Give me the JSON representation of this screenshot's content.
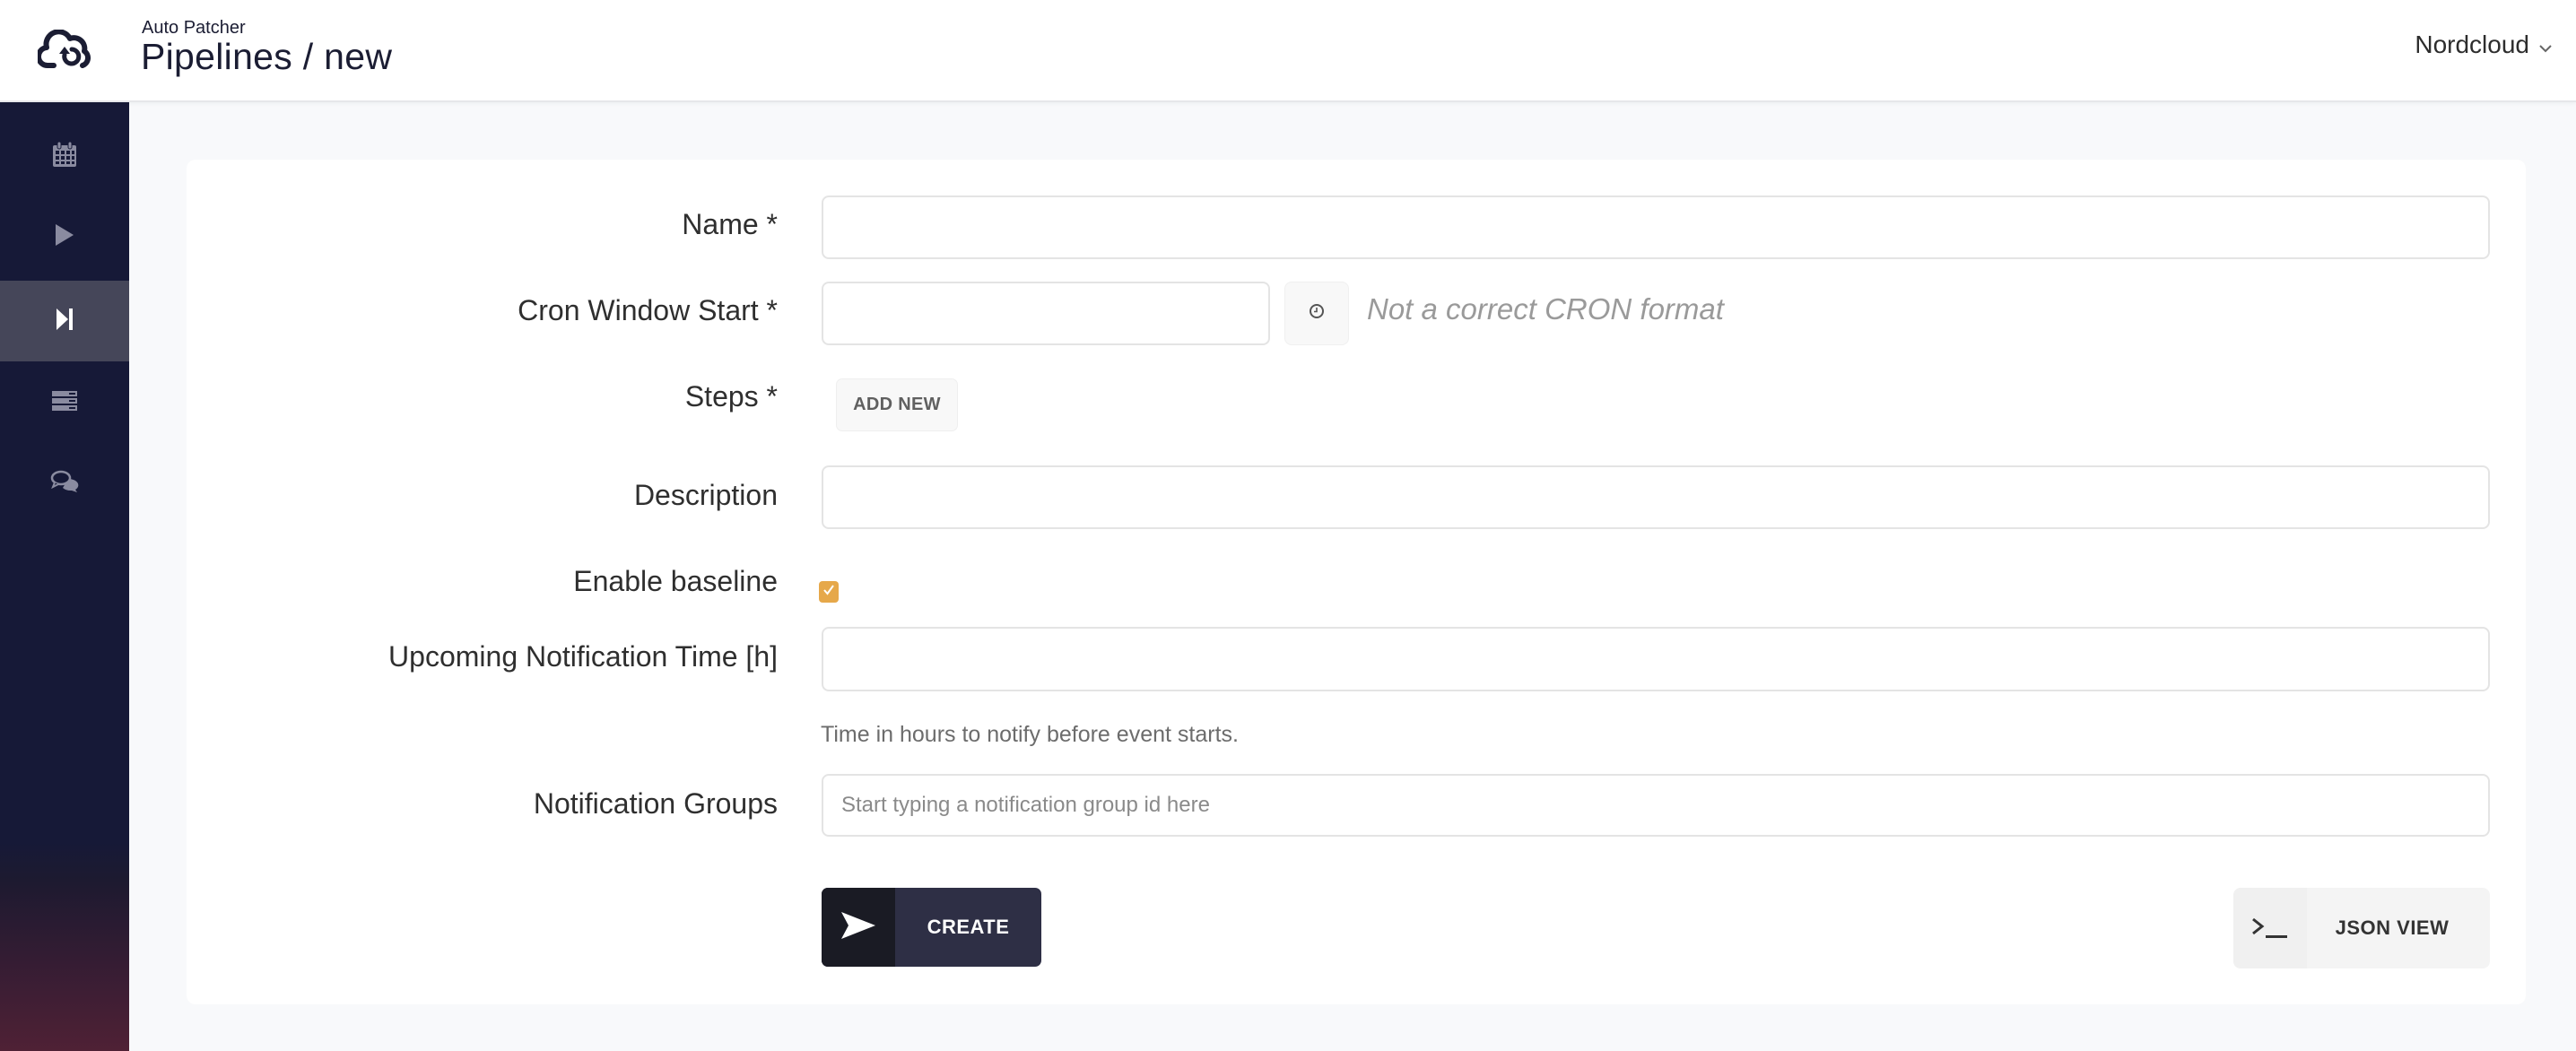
{
  "header": {
    "app_name": "Auto Patcher",
    "page_title": "Pipelines / new",
    "org_name": "Nordcloud",
    "logo_icon": "cloud-upload-icon"
  },
  "sidebar": {
    "items": [
      {
        "icon": "calendar-icon",
        "active": false
      },
      {
        "icon": "play-icon",
        "active": false
      },
      {
        "icon": "skip-forward-icon",
        "active": true
      },
      {
        "icon": "server-list-icon",
        "active": false
      },
      {
        "icon": "chat-bubbles-icon",
        "active": false
      }
    ]
  },
  "form": {
    "name": {
      "label": "Name *",
      "value": ""
    },
    "cron_window_start": {
      "label": "Cron Window Start *",
      "value": "",
      "error": "Not a correct CRON format",
      "picker_icon": "clock-icon"
    },
    "steps": {
      "label": "Steps *",
      "add_button": "ADD NEW"
    },
    "description": {
      "label": "Description",
      "value": ""
    },
    "enable_baseline": {
      "label": "Enable baseline",
      "checked": true
    },
    "upcoming_notification_time": {
      "label": "Upcoming Notification Time [h]",
      "value": "",
      "help": "Time in hours to notify before event starts."
    },
    "notification_groups": {
      "label": "Notification Groups",
      "placeholder": "Start typing a notification group id here"
    }
  },
  "actions": {
    "create_label": "CREATE",
    "json_view_label": "JSON VIEW"
  },
  "colors": {
    "sidebar_bg": "#161937",
    "sidebar_active": "#454659",
    "checkbox_accent": "#e6a84a",
    "create_button": "#2e2f45"
  }
}
